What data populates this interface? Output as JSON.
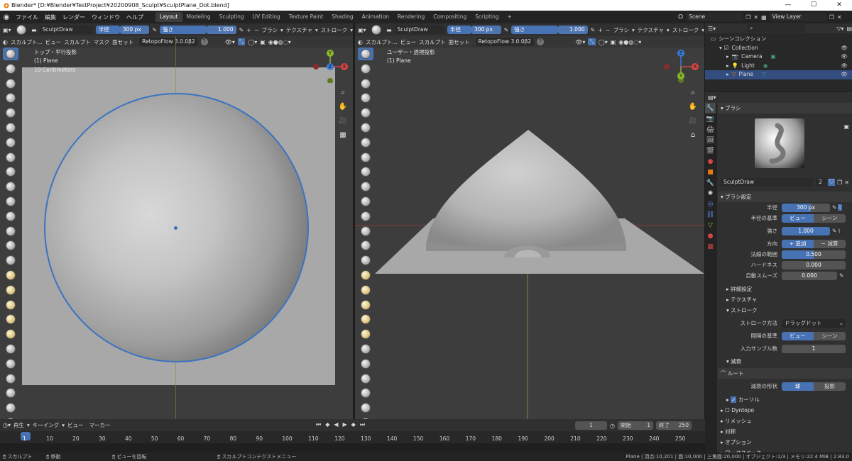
{
  "window": {
    "title": "Blender* [D:¥Blender¥TestProject¥20200908_Sculpt¥SculptPlane_Dot.blend]",
    "min": "—",
    "max": "☐",
    "close": "✕"
  },
  "menu": {
    "items": [
      "ファイル",
      "編集",
      "レンダー",
      "ウィンドウ",
      "ヘルプ"
    ]
  },
  "workspaces": {
    "tabs": [
      "Layout",
      "Modeling",
      "Sculpting",
      "UV Editing",
      "Texture Paint",
      "Shading",
      "Animation",
      "Rendering",
      "Compositing",
      "Scripting"
    ],
    "active": 0,
    "add": "+"
  },
  "scene": {
    "name": "Scene",
    "view_layer": "View Layer"
  },
  "tool_header": {
    "brush_name": "SculptDraw",
    "radius_label": "半径",
    "radius_value": "300 px",
    "strength_label": "強さ",
    "strength_value": "1.000",
    "brush_menu": "ブラシ",
    "texture_menu": "テクスチャ",
    "stroke_menu": "ストローク",
    "minus": "−",
    "plus": "+"
  },
  "left_view": {
    "mode": "スカルプト...",
    "menus": [
      "ビュー",
      "スカルプト",
      "マスク",
      "面セット"
    ],
    "addon": "RetopoFlow 3.0.0β2",
    "title": "トップ・平行投影",
    "object": "(1) Plane",
    "scale": "10 Centimeters",
    "gizmo": {
      "y": "Y",
      "z": "Z",
      "x": "X"
    }
  },
  "right_view": {
    "mode": "スカルプト...",
    "menus": [
      "ビュー",
      "スカルプト",
      "面セット"
    ],
    "addon": "RetopoFlow 3.0.0β2",
    "title": "ユーザー・透視投影",
    "object": "(1) Plane",
    "gizmo": {
      "y": "Y",
      "z": "Z",
      "x": "X"
    }
  },
  "outliner": {
    "root": "シーンコレクション",
    "collection": "Collection",
    "items": [
      {
        "name": "Camera"
      },
      {
        "name": "Light"
      },
      {
        "name": "Plane"
      }
    ],
    "selected": 2
  },
  "properties": {
    "brush_panel": "ブラシ",
    "brush_name": "SculptDraw",
    "brush_users": "2",
    "settings_panel": "ブラシ設定",
    "rows": {
      "radius": {
        "label": "半径",
        "value": "300 px",
        "fill": 0.6
      },
      "radius_base": {
        "label": "半径の基準",
        "options": [
          "ビュー",
          "シーン"
        ],
        "selected": 0
      },
      "strength": {
        "label": "強さ",
        "value": "1.000",
        "fill": 1.0
      },
      "direction": {
        "label": "方向",
        "options": [
          "+ 追加",
          "− 減算"
        ],
        "selected": 0
      },
      "normal_radius": {
        "label": "法線の範囲",
        "value": "0.500",
        "fill": 0.5
      },
      "hardness": {
        "label": "ハードネス",
        "value": "0.000",
        "fill": 0.0
      },
      "auto_smooth": {
        "label": "自動スムーズ",
        "value": "0.000",
        "fill": 0.0
      }
    },
    "subpanels": [
      "詳細設定",
      "テクスチャ",
      "ストローク"
    ],
    "stroke": {
      "method_label": "ストローク方法",
      "method_value": "ドラッグドット",
      "spacing_label": "間隔の基準",
      "spacing_options": [
        "ビュー",
        "シーン"
      ],
      "spacing_selected": 0,
      "samples_label": "入力サンプル数",
      "samples_value": "1"
    },
    "falloff_panel": "減衰",
    "falloff_preset": "ルート",
    "falloff_shape_label": "減衰の形状",
    "falloff_shape_options": [
      "球",
      "投影"
    ],
    "falloff_shape_selected": 0,
    "cursor_label": "カーソル",
    "bottom_panels": [
      "Dyntopo",
      "リメッシュ",
      "対称",
      "オプション",
      "ワークスペース"
    ]
  },
  "timeline": {
    "menus": [
      "再生",
      "キーイング",
      "ビュー",
      "マーカー"
    ],
    "current_frame": "1",
    "start_label": "開始",
    "start": "1",
    "end_label": "終了",
    "end": "250",
    "ticks": [
      "1",
      "10",
      "20",
      "30",
      "40",
      "50",
      "60",
      "70",
      "80",
      "90",
      "100",
      "110",
      "120",
      "130",
      "140",
      "150",
      "160",
      "170",
      "180",
      "190",
      "200",
      "210",
      "220",
      "230",
      "240",
      "250"
    ]
  },
  "statusbar": {
    "hints": [
      "スカルプト",
      "移動",
      "ビューを回転",
      "スカルプトコンテクストメニュー"
    ],
    "info": "Plane | 頂点:10,201 | 面:10,000 | 三角面:20,000 | オブジェクト:1/3 | メモリ:22.4 MiB | 2.83.0"
  },
  "colors": {
    "accent": "#4772b3",
    "bg": "#303030",
    "viewport": "#3d3d3d",
    "grid": "#a8a8a8",
    "x_axis": "#d44444",
    "y_axis": "#8ab92c",
    "z_axis": "#3b7bd6"
  }
}
